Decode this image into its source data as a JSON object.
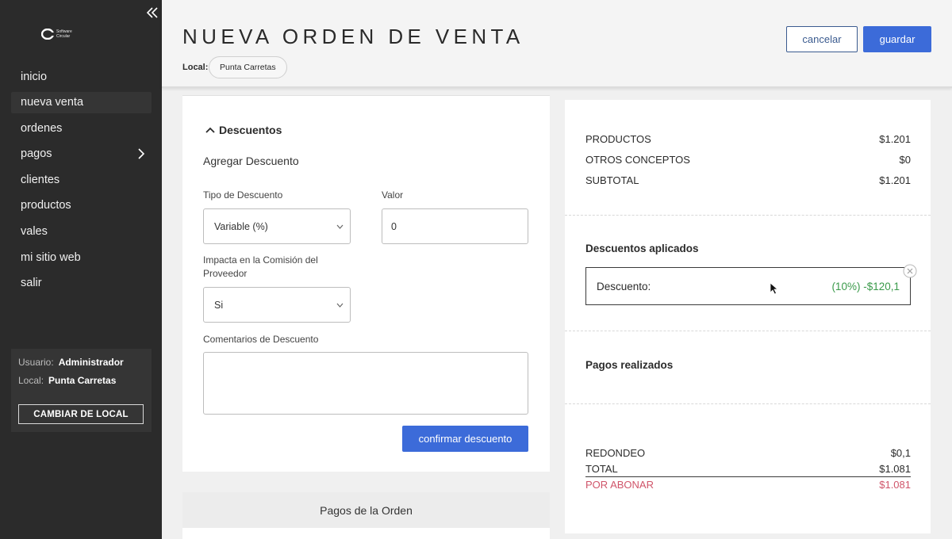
{
  "sidebar": {
    "brand": {
      "line1": "Software",
      "line2": "Circular"
    },
    "nav": [
      {
        "label": "inicio",
        "active": false,
        "has_arrow": false
      },
      {
        "label": "nueva venta",
        "active": true,
        "has_arrow": false
      },
      {
        "label": "ordenes",
        "active": false,
        "has_arrow": false
      },
      {
        "label": "pagos",
        "active": false,
        "has_arrow": true
      },
      {
        "label": "clientes",
        "active": false,
        "has_arrow": false
      },
      {
        "label": "productos",
        "active": false,
        "has_arrow": false
      },
      {
        "label": "vales",
        "active": false,
        "has_arrow": false
      },
      {
        "label": "mi sitio web",
        "active": false,
        "has_arrow": false
      },
      {
        "label": "salir",
        "active": false,
        "has_arrow": false
      }
    ],
    "user": {
      "usuario_label": "Usuario:",
      "usuario_value": "Administrador",
      "local_label": "Local:",
      "local_value": "Punta Carretas",
      "change_button": "CAMBIAR DE LOCAL"
    }
  },
  "header": {
    "title": "NUEVA ORDEN DE VENTA",
    "local_label": "Local:",
    "local_chip": "Punta Carretas",
    "cancel_label": "cancelar",
    "save_label": "guardar"
  },
  "discount_form": {
    "section_title": "Descuentos",
    "subtitle": "Agregar Descuento",
    "tipo_label": "Tipo de Descuento",
    "tipo_value": "Variable (%)",
    "valor_label": "Valor",
    "valor_value": "0",
    "comision_label": "Impacta en la Comisión del Proveedor",
    "comision_value": "Si",
    "comentarios_label": "Comentarios de Descuento",
    "comentarios_value": "",
    "confirm_label": "confirmar descuento"
  },
  "pagos_orden": {
    "title": "Pagos de la Orden"
  },
  "summary": {
    "productos_label": "PRODUCTOS",
    "productos_value": "$1.201",
    "otros_label": "OTROS CONCEPTOS",
    "otros_value": "$0",
    "subtotal_label": "SUBTOTAL",
    "subtotal_value": "$1.201",
    "descuentos_title": "Descuentos aplicados",
    "descuento_label": "Descuento:",
    "descuento_value": "(10%) -$120,1",
    "pagos_title": "Pagos realizados",
    "redondeo_label": "REDONDEO",
    "redondeo_value": "$0,1",
    "total_label": "TOTAL",
    "total_value": "$1.081",
    "abonar_label": "POR ABONAR",
    "abonar_value": "$1.081"
  },
  "colors": {
    "sidebar_bg": "#2b2b2b",
    "primary": "#3c6bd9",
    "cancel_border": "#3b5b8f",
    "discount_green": "#3a9a4a",
    "por_abonar_red": "#d0556a"
  },
  "icons": [
    "collapse-sidebar-icon",
    "chevron-right-icon",
    "chevron-up-icon",
    "chevron-down-icon",
    "remove-icon",
    "mouse-cursor-icon"
  ]
}
